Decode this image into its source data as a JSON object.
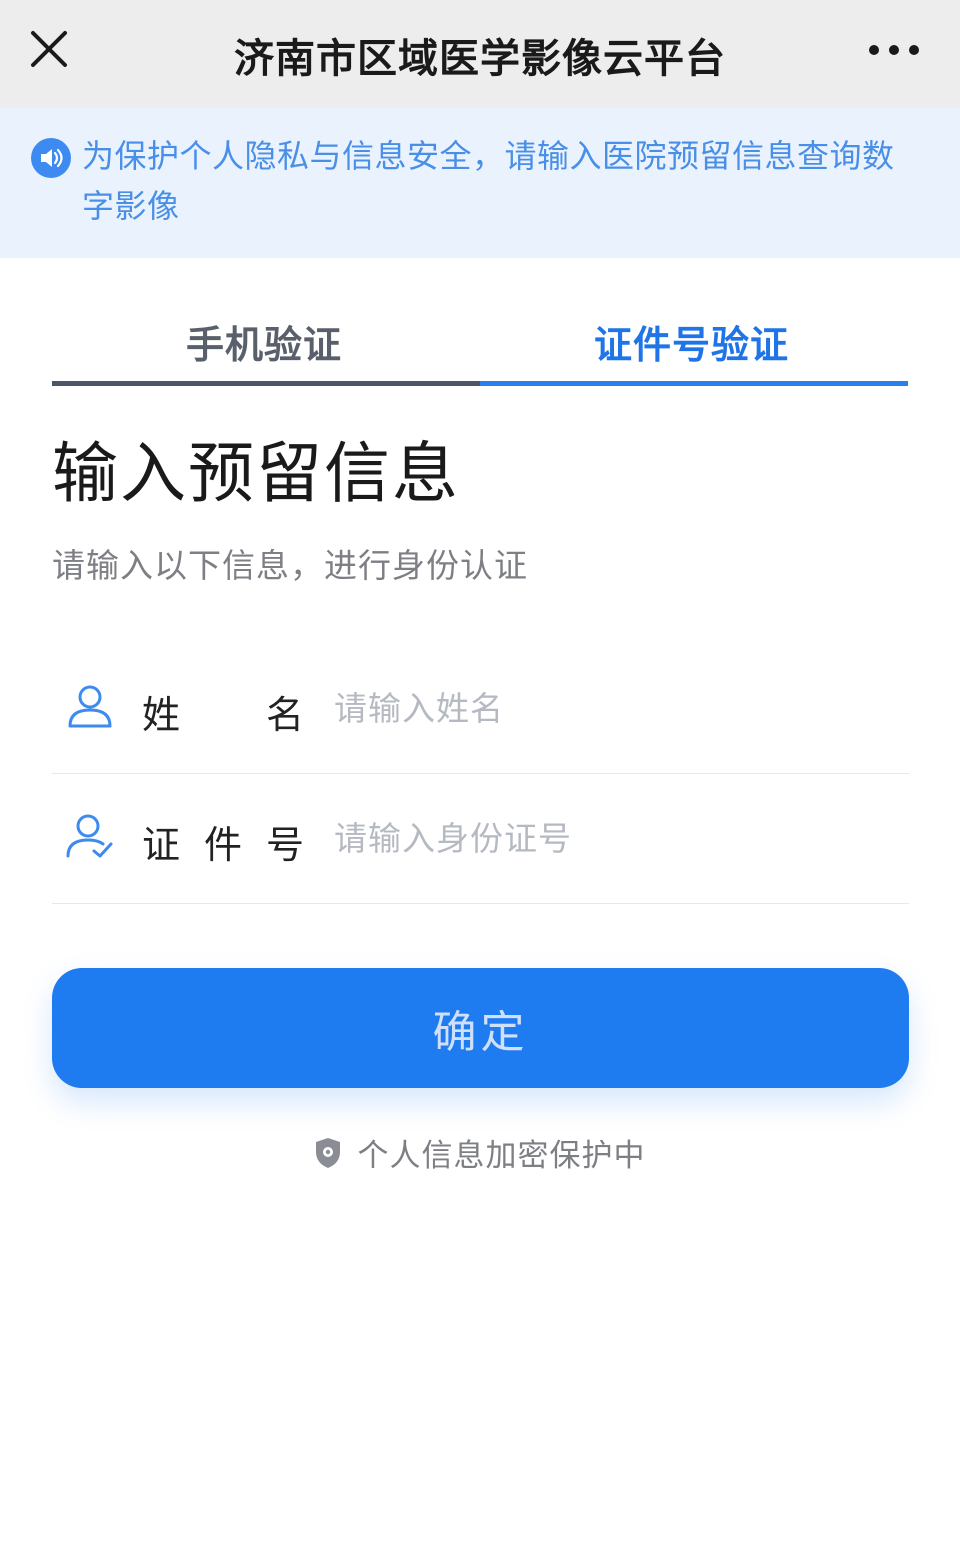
{
  "titlebar": {
    "title": "济南市区域医学影像云平台",
    "close_icon": "close-icon",
    "more_icon": "more-icon"
  },
  "notice": {
    "icon": "speaker-icon",
    "text": "为保护个人隐私与信息安全，请输入医院预留信息查询数字影像"
  },
  "tabs": [
    {
      "label": "手机验证",
      "active": false
    },
    {
      "label": "证件号验证",
      "active": true
    }
  ],
  "form": {
    "heading": "输入预留信息",
    "subheading": "请输入以下信息，进行身份认证",
    "name_field": {
      "label_chars": [
        "姓",
        "名"
      ],
      "placeholder": "请输入姓名",
      "value": "",
      "icon": "user-icon"
    },
    "id_field": {
      "label_chars": [
        "证",
        "件",
        "号"
      ],
      "placeholder": "请输入身份证号",
      "value": "",
      "icon": "user-verified-icon"
    },
    "confirm_label": "确定",
    "secure_text": "个人信息加密保护中",
    "secure_icon": "shield-icon"
  },
  "colors": {
    "accent": "#1e7bf0",
    "notice_bg": "#eaf3fd",
    "notice_text": "#4a8fe7",
    "titlebar_bg": "#ededed"
  }
}
